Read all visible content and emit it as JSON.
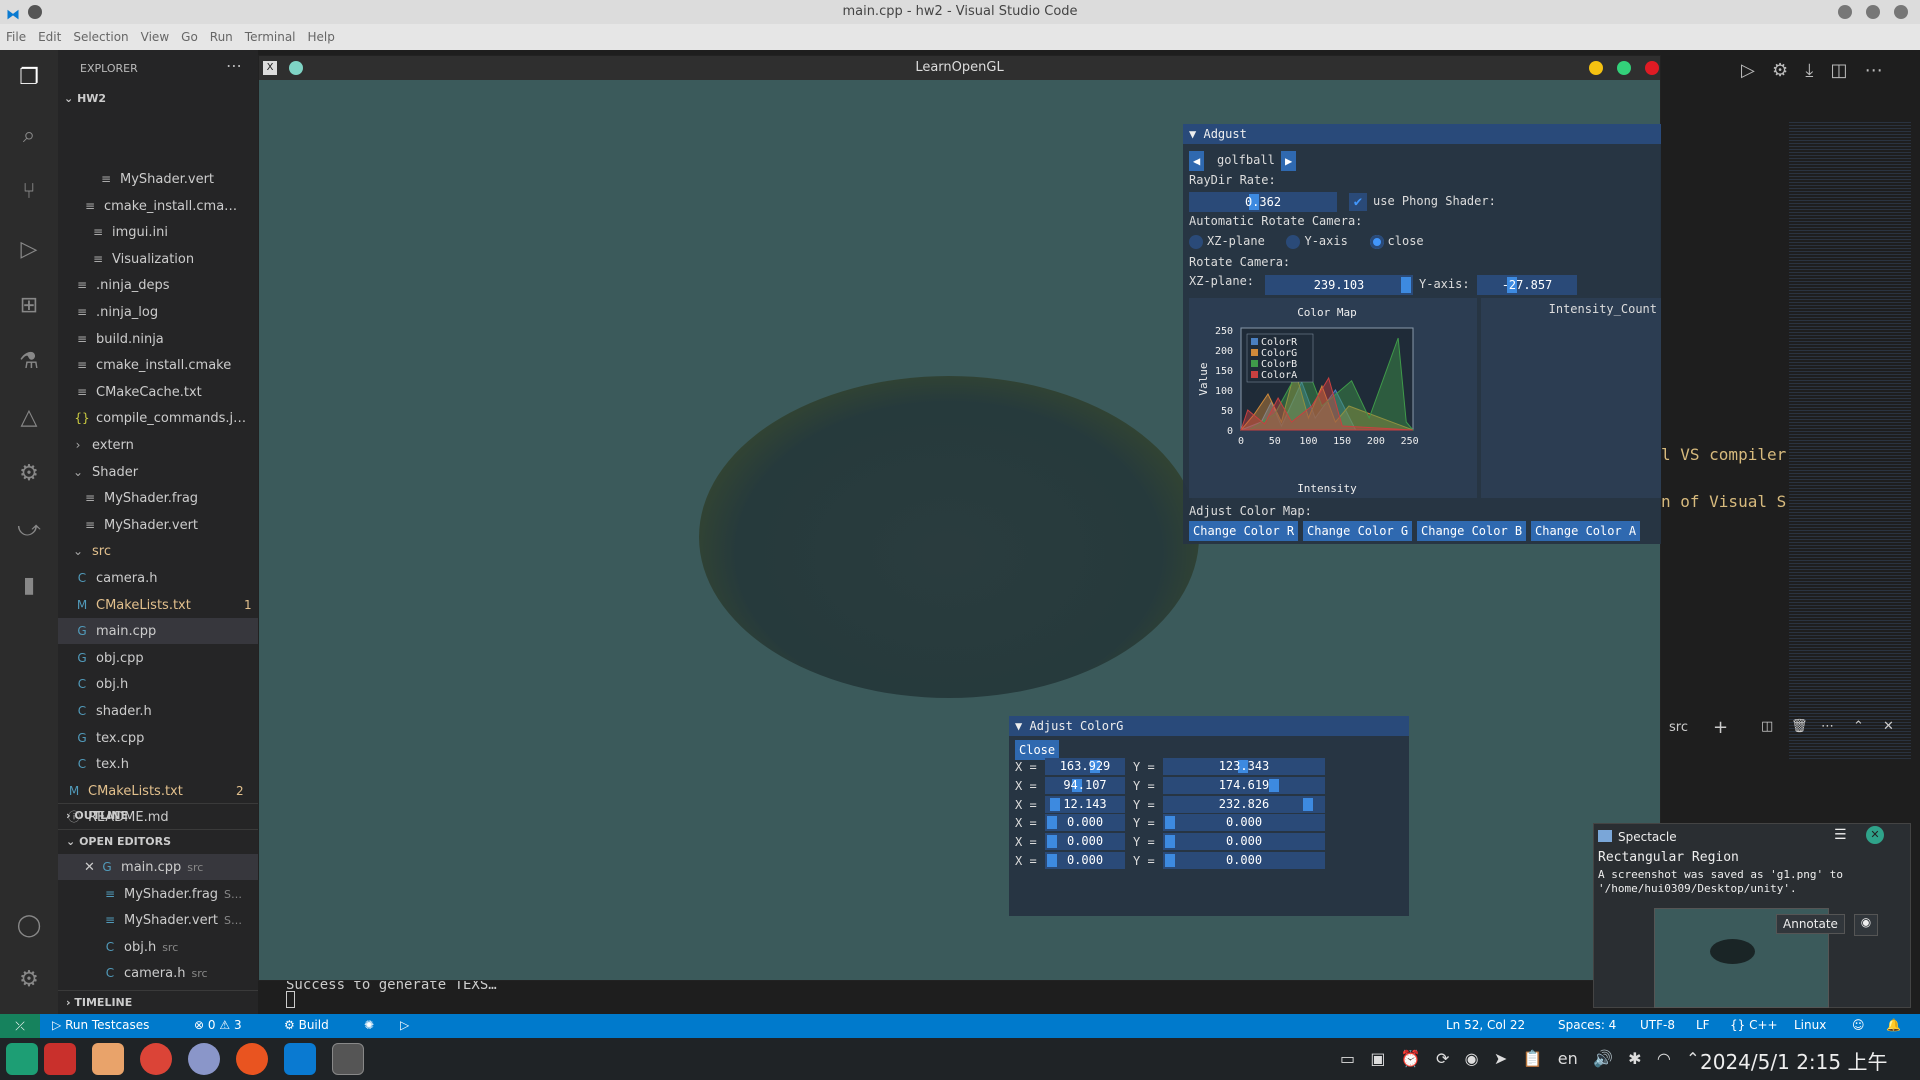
{
  "window": {
    "title": "main.cpp - hw2 - Visual Studio Code"
  },
  "menu": [
    "File",
    "Edit",
    "Selection",
    "View",
    "Go",
    "Run",
    "Terminal",
    "Help"
  ],
  "explorer": {
    "title": "EXPLORER",
    "root": "HW2",
    "items": [
      {
        "label": "MyShader.vert",
        "icon": "≡",
        "color": "#cccccc"
      },
      {
        "label": "cmake_install.cma…",
        "icon": "≡",
        "color": "#cccccc"
      },
      {
        "label": "imgui.ini",
        "icon": "≡",
        "color": "#cccccc"
      },
      {
        "label": "Visualization",
        "icon": "≡",
        "color": "#cccccc"
      },
      {
        "label": ".ninja_deps",
        "icon": "≡",
        "color": "#cccccc"
      },
      {
        "label": ".ninja_log",
        "icon": "≡",
        "color": "#cccccc"
      },
      {
        "label": "build.ninja",
        "icon": "≡",
        "color": "#cccccc"
      },
      {
        "label": "cmake_install.cmake",
        "icon": "≡",
        "color": "#cccccc"
      },
      {
        "label": "CMakeCache.txt",
        "icon": "≡",
        "color": "#cccccc"
      },
      {
        "label": "compile_commands.j…",
        "icon": "{}",
        "color": "#cccccc"
      },
      {
        "label": "extern",
        "icon": "›",
        "color": "#cccccc"
      },
      {
        "label": "Shader",
        "icon": "⌄",
        "color": "#cccccc"
      },
      {
        "label": "MyShader.frag",
        "icon": "≡",
        "color": "#cccccc"
      },
      {
        "label": "MyShader.vert",
        "icon": "≡",
        "color": "#cccccc"
      },
      {
        "label": "src",
        "icon": "⌄",
        "color": "#e2c08d"
      },
      {
        "label": "camera.h",
        "icon": "C",
        "color": "#cccccc"
      },
      {
        "label": "CMakeLists.txt",
        "icon": "M",
        "color": "#e2c08d",
        "badge": "1"
      },
      {
        "label": "main.cpp",
        "icon": "G",
        "color": "#cccccc"
      },
      {
        "label": "obj.cpp",
        "icon": "G",
        "color": "#cccccc"
      },
      {
        "label": "obj.h",
        "icon": "C",
        "color": "#cccccc"
      },
      {
        "label": "shader.h",
        "icon": "C",
        "color": "#cccccc"
      },
      {
        "label": "tex.cpp",
        "icon": "G",
        "color": "#cccccc"
      },
      {
        "label": "tex.h",
        "icon": "C",
        "color": "#cccccc"
      },
      {
        "label": "CMakeLists.txt",
        "icon": "M",
        "color": "#e2c08d",
        "badge": "2"
      },
      {
        "label": "README.md",
        "icon": "ⓘ",
        "color": "#cccccc"
      }
    ],
    "outline": "OUTLINE",
    "open_editors": "OPEN EDITORS",
    "open_items": [
      {
        "label": "main.cpp",
        "hint": "src",
        "icon": "G"
      },
      {
        "label": "MyShader.frag",
        "hint": "S…",
        "icon": "≡"
      },
      {
        "label": "MyShader.vert",
        "hint": "S…",
        "icon": "≡"
      },
      {
        "label": "obj.h",
        "hint": "src",
        "icon": "C"
      },
      {
        "label": "camera.h",
        "hint": "src",
        "icon": "C"
      }
    ],
    "timeline": "TIMELINE"
  },
  "gl": {
    "title": "LearnOpenGL",
    "adjust": {
      "title": "Adgust",
      "model": "golfball",
      "raydir_label": "RayDir Rate:",
      "raydir_value": "0.362",
      "phong_label": "use Phong Shader:",
      "auto_rotate_label": "Automatic Rotate Camera:",
      "radios": [
        "XZ-plane",
        "Y-axis",
        "close"
      ],
      "rotate_label": "Rotate Camera:",
      "xz_label": "XZ-plane:",
      "xz_value": "239.103",
      "y_label": "Y-axis:",
      "y_value": "-27.857",
      "colormap_label": "Adjust Color Map:",
      "buttons": [
        "Change Color R",
        "Change Color G",
        "Change Color B",
        "Change Color A"
      ]
    },
    "intensity_title": "Intensity_Count",
    "colorg": {
      "title": "Adjust ColorG",
      "close": "Close",
      "rows": [
        {
          "x": "163.929",
          "y": "123.343",
          "xg": 0.655,
          "yg": 0.49
        },
        {
          "x": "94.107",
          "y": "174.619",
          "xg": 0.375,
          "yg": 0.7
        },
        {
          "x": "12.143",
          "y": "232.826",
          "xg": 0.05,
          "yg": 0.93
        },
        {
          "x": "0.000",
          "y": "0.000",
          "xg": 0,
          "yg": 0
        },
        {
          "x": "0.000",
          "y": "0.000",
          "xg": 0,
          "yg": 0
        },
        {
          "x": "0.000",
          "y": "0.000",
          "xg": 0,
          "yg": 0
        }
      ]
    }
  },
  "chart_data": {
    "type": "area",
    "title": "Color Map",
    "xlabel": "Intensity",
    "ylabel": "Value",
    "xlim": [
      0,
      255
    ],
    "ylim": [
      0,
      255
    ],
    "x_ticks": [
      0,
      50,
      100,
      150,
      200,
      250
    ],
    "y_ticks": [
      0,
      50,
      100,
      150,
      200,
      250
    ],
    "series": [
      {
        "name": "ColorR",
        "color": "#4a7fc0",
        "x": [
          0,
          30,
          45,
          60,
          90,
          110,
          140,
          170,
          255
        ],
        "y": [
          0,
          20,
          70,
          10,
          120,
          30,
          100,
          0,
          0
        ]
      },
      {
        "name": "ColorG",
        "color": "#d08a3a",
        "x": [
          0,
          20,
          40,
          60,
          80,
          100,
          120,
          140,
          160,
          255
        ],
        "y": [
          0,
          40,
          90,
          20,
          150,
          30,
          110,
          20,
          60,
          0
        ]
      },
      {
        "name": "ColorB",
        "color": "#3f9a4a",
        "x": [
          0,
          12,
          50,
          94,
          120,
          164,
          190,
          233,
          245,
          255
        ],
        "y": [
          0,
          0,
          40,
          175,
          60,
          123,
          30,
          230,
          20,
          0
        ]
      },
      {
        "name": "ColorA",
        "color": "#c84040",
        "x": [
          0,
          10,
          35,
          55,
          75,
          105,
          130,
          150,
          255
        ],
        "y": [
          0,
          50,
          15,
          80,
          20,
          60,
          130,
          10,
          0
        ]
      }
    ]
  },
  "terminal": {
    "text": "Success to generate TEXS…"
  },
  "right": {
    "line1": "l VS compiler",
    "line2": "n of Visual S",
    "terminal_label": "src"
  },
  "spectacle": {
    "app": "Spectacle",
    "heading": "Rectangular Region",
    "body": "A screenshot was saved as 'g1.png' to '/home/hui0309/Desktop/unity'.",
    "annotate": "Annotate"
  },
  "status": {
    "run": "Run Testcases",
    "errors": "0",
    "warnings": "3",
    "build": "Build",
    "position": "Ln 52, Col 22",
    "spaces": "Spaces: 4",
    "encoding": "UTF-8",
    "eol": "LF",
    "lang": "{} C++",
    "os": "Linux"
  },
  "taskbar": {
    "lang": "en",
    "date": "2024/5/1",
    "time": "2:15",
    "ampm": "上午"
  }
}
